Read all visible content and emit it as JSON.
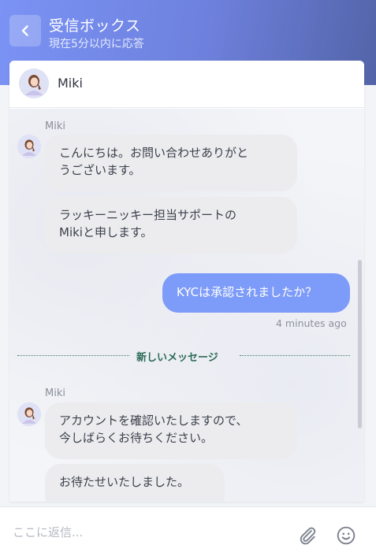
{
  "header": {
    "title": "受信ボックス",
    "subtitle": "現在5分以内に応答"
  },
  "agent": {
    "name": "Miki"
  },
  "messages": {
    "group1": {
      "sender": "Miki",
      "bubble1_line1": "こんにちは。お問い合わせありがと",
      "bubble1_line2": "うございます。",
      "bubble2_line1": "ラッキーニッキー担当サポートの",
      "bubble2_line2": "Mikiと申します。"
    },
    "outgoing": {
      "text": "KYCは承認されましたか？",
      "timestamp": "4 minutes ago"
    },
    "divider_label": "新しいメッセージ",
    "group2": {
      "sender": "Miki",
      "bubble1_line1": "アカウントを確認いたしますので、",
      "bubble1_line2": "今しばらくお待ちください。",
      "bubble2": "お待たせいたしました。"
    }
  },
  "composer": {
    "placeholder": "ここに返信..."
  },
  "colors": {
    "header_start": "#7b93f5",
    "header_end": "#5364a8",
    "outgoing_bubble": "#7d9bf8",
    "incoming_bubble": "#ececee",
    "divider_accent": "#2d6b54"
  },
  "icons": {
    "back": "chevron-left-icon",
    "attach": "paperclip-icon",
    "emoji": "smiley-icon"
  }
}
